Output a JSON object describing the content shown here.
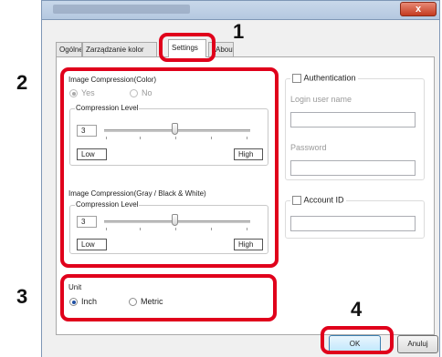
{
  "window": {
    "close_glyph": "x"
  },
  "tabs": [
    {
      "label": "Ogólne"
    },
    {
      "label": "Zarządzanie kolor"
    },
    {
      "label": "Settings"
    },
    {
      "label": "About"
    }
  ],
  "callouts": {
    "c1": "1",
    "c2": "2",
    "c3": "3",
    "c4": "4"
  },
  "color_compression": {
    "title": "Image Compression(Color)",
    "yes": "Yes",
    "no": "No",
    "selected": "Yes",
    "level_title": "Compression Level",
    "level_value": "3",
    "low": "Low",
    "high": "High"
  },
  "gray_compression": {
    "title": "Image Compression(Gray / Black & White)",
    "level_title": "Compression Level",
    "level_value": "3",
    "low": "Low",
    "high": "High"
  },
  "unit": {
    "title": "Unit",
    "inch": "Inch",
    "metric": "Metric",
    "selected": "Inch"
  },
  "authentication": {
    "label": "Authentication",
    "checked": false,
    "login_label": "Login user name",
    "login_value": "",
    "password_label": "Password",
    "password_value": ""
  },
  "account": {
    "label": "Account ID",
    "checked": false,
    "value": ""
  },
  "buttons": {
    "ok": "OK",
    "cancel": "Anuluj"
  },
  "colors": {
    "highlight": "#e0001b",
    "radio_selected": "#1f4fa3"
  },
  "icons": {
    "close": "close-icon",
    "slider": "slider-thumb-icon"
  }
}
